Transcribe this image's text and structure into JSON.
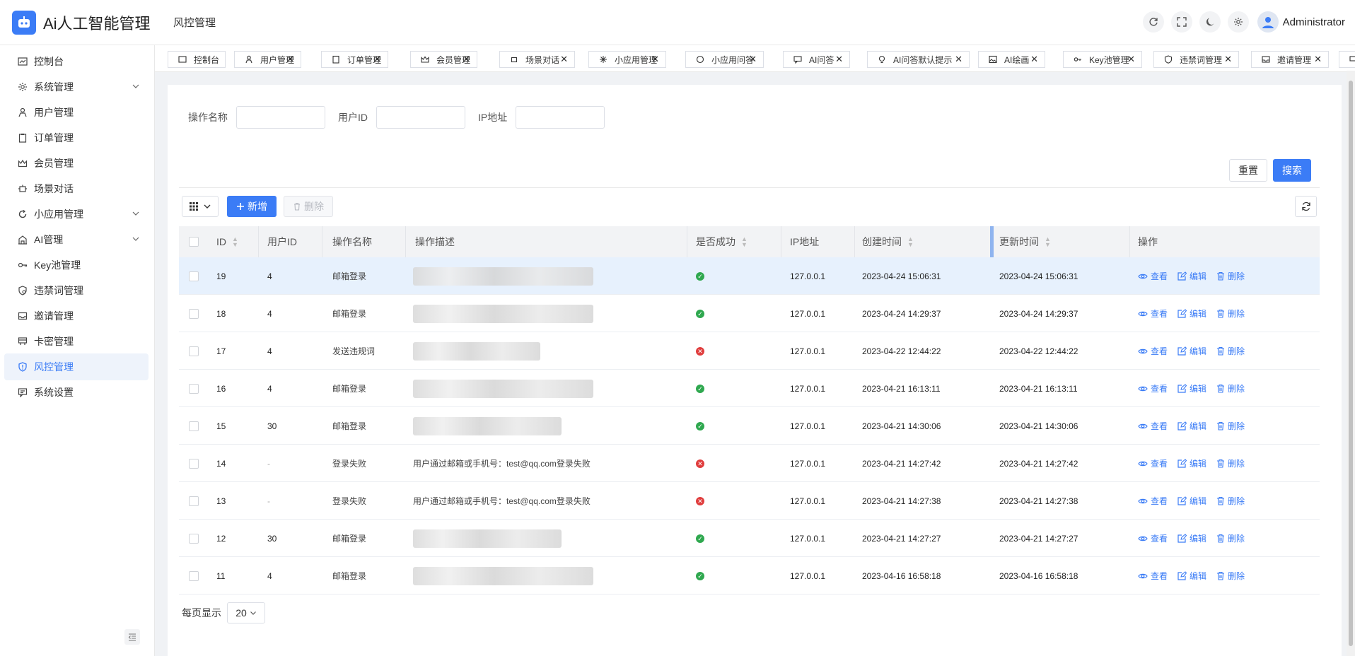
{
  "header": {
    "app_title": "Ai人工智能管理",
    "breadcrumb": "风控管理",
    "user_name": "Administrator"
  },
  "sidebar": {
    "items": [
      {
        "label": "控制台",
        "icon": "dashboard-icon"
      },
      {
        "label": "系统管理",
        "icon": "gear-icon",
        "expandable": true
      },
      {
        "label": "用户管理",
        "icon": "user-icon"
      },
      {
        "label": "订单管理",
        "icon": "clipboard-icon"
      },
      {
        "label": "会员管理",
        "icon": "crown-icon"
      },
      {
        "label": "场景对话",
        "icon": "robot-icon"
      },
      {
        "label": "小应用管理",
        "icon": "refresh-app-icon",
        "expandable": true
      },
      {
        "label": "AI管理",
        "icon": "ai-icon",
        "expandable": true
      },
      {
        "label": "Key池管理",
        "icon": "key-icon"
      },
      {
        "label": "违禁词管理",
        "icon": "shield-icon"
      },
      {
        "label": "邀请管理",
        "icon": "inbox-icon"
      },
      {
        "label": "卡密管理",
        "icon": "card-icon"
      },
      {
        "label": "风控管理",
        "icon": "risk-shield-icon",
        "active": true
      },
      {
        "label": "系统设置",
        "icon": "settings-chat-icon"
      }
    ]
  },
  "tabs": [
    {
      "label": "控制台",
      "closable": false
    },
    {
      "label": "用户管理",
      "closable": true
    },
    {
      "label": "订单管理",
      "closable": true
    },
    {
      "label": "会员管理",
      "closable": true
    },
    {
      "label": "场景对话",
      "closable": true
    },
    {
      "label": "小应用管理",
      "closable": true
    },
    {
      "label": "小应用问答",
      "closable": true
    },
    {
      "label": "AI问答",
      "closable": true
    },
    {
      "label": "AI问答默认提示",
      "closable": true
    },
    {
      "label": "AI绘画",
      "closable": true
    },
    {
      "label": "Key池管理",
      "closable": true
    },
    {
      "label": "违禁词管理",
      "closable": true
    },
    {
      "label": "邀请管理",
      "closable": true
    }
  ],
  "filter": {
    "op_name_label": "操作名称",
    "op_name_value": "",
    "user_id_label": "用户ID",
    "user_id_value": "",
    "ip_label": "IP地址",
    "ip_value": "",
    "reset_label": "重置",
    "search_label": "搜索"
  },
  "toolbar": {
    "add_label": "新增",
    "delete_label": "删除"
  },
  "table": {
    "columns": {
      "id": "ID",
      "user_id": "用户ID",
      "op_name": "操作名称",
      "op_desc": "操作描述",
      "success": "是否成功",
      "ip": "IP地址",
      "created": "创建时间",
      "updated": "更新时间",
      "actions": "操作"
    },
    "action_labels": {
      "view": "查看",
      "edit": "编辑",
      "delete": "删除"
    },
    "rows": [
      {
        "id": "19",
        "user_id": "4",
        "op_name": "邮箱登录",
        "op_desc": "",
        "success": true,
        "ip": "127.0.0.1",
        "created": "2023-04-24 15:06:31",
        "updated": "2023-04-24 15:06:31"
      },
      {
        "id": "18",
        "user_id": "4",
        "op_name": "邮箱登录",
        "op_desc": "",
        "success": true,
        "ip": "127.0.0.1",
        "created": "2023-04-24 14:29:37",
        "updated": "2023-04-24 14:29:37"
      },
      {
        "id": "17",
        "user_id": "4",
        "op_name": "发送违规词",
        "op_desc": "",
        "success": false,
        "ip": "127.0.0.1",
        "created": "2023-04-22 12:44:22",
        "updated": "2023-04-22 12:44:22"
      },
      {
        "id": "16",
        "user_id": "4",
        "op_name": "邮箱登录",
        "op_desc": "",
        "success": true,
        "ip": "127.0.0.1",
        "created": "2023-04-21 16:13:11",
        "updated": "2023-04-21 16:13:11"
      },
      {
        "id": "15",
        "user_id": "30",
        "op_name": "邮箱登录",
        "op_desc": "",
        "success": true,
        "ip": "127.0.0.1",
        "created": "2023-04-21 14:30:06",
        "updated": "2023-04-21 14:30:06"
      },
      {
        "id": "14",
        "user_id": "-",
        "op_name": "登录失败",
        "op_desc": "用户通过邮箱或手机号：test@qq.com登录失败",
        "success": false,
        "ip": "127.0.0.1",
        "created": "2023-04-21 14:27:42",
        "updated": "2023-04-21 14:27:42"
      },
      {
        "id": "13",
        "user_id": "-",
        "op_name": "登录失败",
        "op_desc": "用户通过邮箱或手机号：test@qq.com登录失败",
        "success": false,
        "ip": "127.0.0.1",
        "created": "2023-04-21 14:27:38",
        "updated": "2023-04-21 14:27:38"
      },
      {
        "id": "12",
        "user_id": "30",
        "op_name": "邮箱登录",
        "op_desc": "",
        "success": true,
        "ip": "127.0.0.1",
        "created": "2023-04-21 14:27:27",
        "updated": "2023-04-21 14:27:27"
      },
      {
        "id": "11",
        "user_id": "4",
        "op_name": "邮箱登录",
        "op_desc": "",
        "success": true,
        "ip": "127.0.0.1",
        "created": "2023-04-16 16:58:18",
        "updated": "2023-04-16 16:58:18"
      }
    ]
  },
  "pager": {
    "page_size_label": "每页显示",
    "page_size_value": "20"
  },
  "colors": {
    "primary": "#3b7cf6",
    "success": "#2fa84f",
    "danger": "#e03d3d",
    "row_highlight": "#e7f1fd"
  }
}
